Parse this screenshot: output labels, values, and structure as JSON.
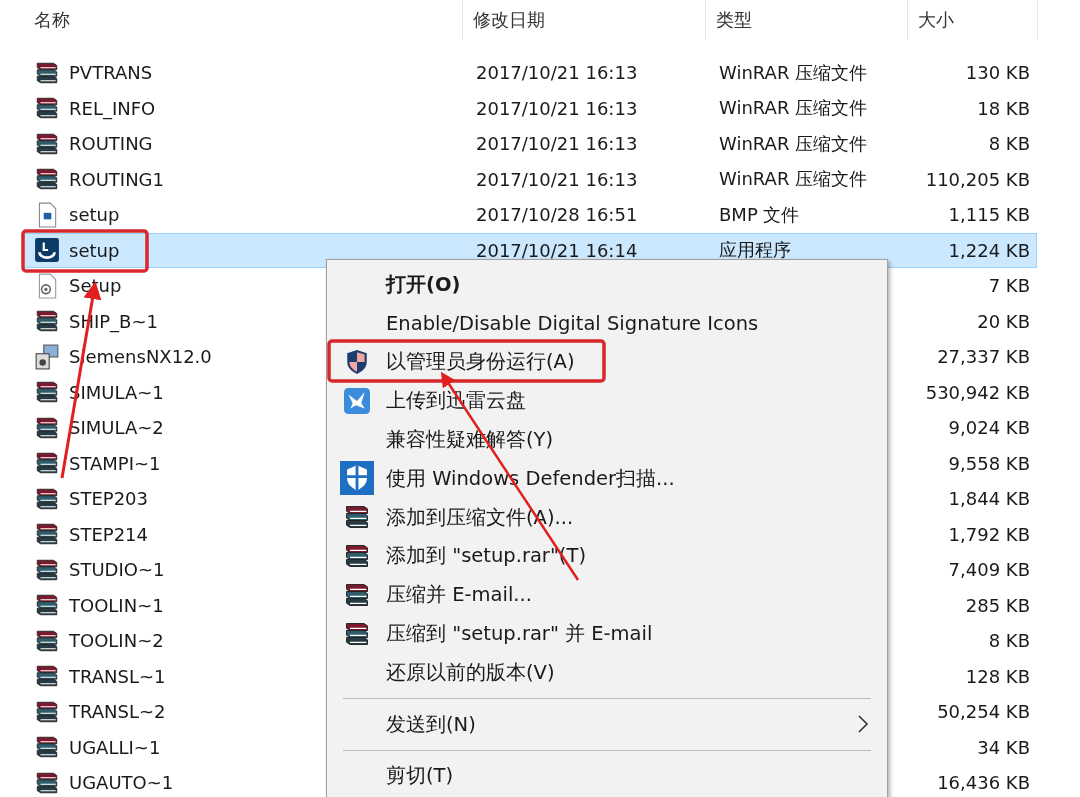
{
  "columns": [
    "名称",
    "修改日期",
    "类型",
    "大小"
  ],
  "files": [
    {
      "kind": "archive",
      "name": "PVTRANS",
      "date": "2017/10/21 16:13",
      "type": "WinRAR 压缩文件",
      "size": "130 KB",
      "selected": false
    },
    {
      "kind": "archive",
      "name": "REL_INFO",
      "date": "2017/10/21 16:13",
      "type": "WinRAR 压缩文件",
      "size": "18 KB",
      "selected": false
    },
    {
      "kind": "archive",
      "name": "ROUTING",
      "date": "2017/10/21 16:13",
      "type": "WinRAR 压缩文件",
      "size": "8 KB",
      "selected": false
    },
    {
      "kind": "archive",
      "name": "ROUTING1",
      "date": "2017/10/21 16:13",
      "type": "WinRAR 压缩文件",
      "size": "110,205 KB",
      "selected": false
    },
    {
      "kind": "image",
      "name": "setup",
      "date": "2017/10/28 16:51",
      "type": "BMP 文件",
      "size": "1,115 KB",
      "selected": false
    },
    {
      "kind": "app",
      "name": "setup",
      "date": "2017/10/21 16:14",
      "type": "应用程序",
      "size": "1,224 KB",
      "selected": true
    },
    {
      "kind": "config",
      "name": "Setup",
      "size": "7 KB",
      "selected": false
    },
    {
      "kind": "archive",
      "name": "SHIP_B~1",
      "size": "20 KB",
      "selected": false
    },
    {
      "kind": "installer",
      "name": "SiemensNX12.0",
      "size": "27,337 KB",
      "selected": false
    },
    {
      "kind": "archive",
      "name": "SIMULA~1",
      "size": "530,942 KB",
      "selected": false
    },
    {
      "kind": "archive",
      "name": "SIMULA~2",
      "size": "9,024 KB",
      "selected": false
    },
    {
      "kind": "archive",
      "name": "STAMPI~1",
      "size": "9,558 KB",
      "selected": false
    },
    {
      "kind": "archive",
      "name": "STEP203",
      "size": "1,844 KB",
      "selected": false
    },
    {
      "kind": "archive",
      "name": "STEP214",
      "size": "1,792 KB",
      "selected": false
    },
    {
      "kind": "archive",
      "name": "STUDIO~1",
      "size": "7,409 KB",
      "selected": false
    },
    {
      "kind": "archive",
      "name": "TOOLIN~1",
      "size": "285 KB",
      "selected": false
    },
    {
      "kind": "archive",
      "name": "TOOLIN~2",
      "size": "8 KB",
      "selected": false
    },
    {
      "kind": "archive",
      "name": "TRANSL~1",
      "size": "128 KB",
      "selected": false
    },
    {
      "kind": "archive",
      "name": "TRANSL~2",
      "size": "50,254 KB",
      "selected": false
    },
    {
      "kind": "archive",
      "name": "UGALLI~1",
      "size": "34 KB",
      "selected": false
    },
    {
      "kind": "archive",
      "name": "UGAUTO~1",
      "size": "16,436 KB",
      "selected": false
    }
  ],
  "context_menu": [
    {
      "kind": "default",
      "label": "打开(O)"
    },
    {
      "kind": "plain",
      "label": "Enable/Disable Digital Signature Icons"
    },
    {
      "kind": "uac",
      "label": "以管理员身份运行(A)"
    },
    {
      "kind": "upload",
      "label": "上传到迅雷云盘"
    },
    {
      "kind": "plain",
      "label": "兼容性疑难解答(Y)"
    },
    {
      "kind": "defender",
      "label": "使用 Windows Defender扫描..."
    },
    {
      "kind": "archive",
      "label": "添加到压缩文件(A)..."
    },
    {
      "kind": "archive",
      "label": "添加到 \"setup.rar\"(T)"
    },
    {
      "kind": "archive",
      "label": "压缩并 E-mail..."
    },
    {
      "kind": "archive",
      "label": "压缩到 \"setup.rar\" 并 E-mail"
    },
    {
      "kind": "plain",
      "label": "还原以前的版本(V)"
    },
    {
      "kind": "separator"
    },
    {
      "kind": "submenu",
      "label": "发送到(N)"
    },
    {
      "kind": "separator"
    },
    {
      "kind": "plain",
      "label": "剪切(T)"
    }
  ]
}
